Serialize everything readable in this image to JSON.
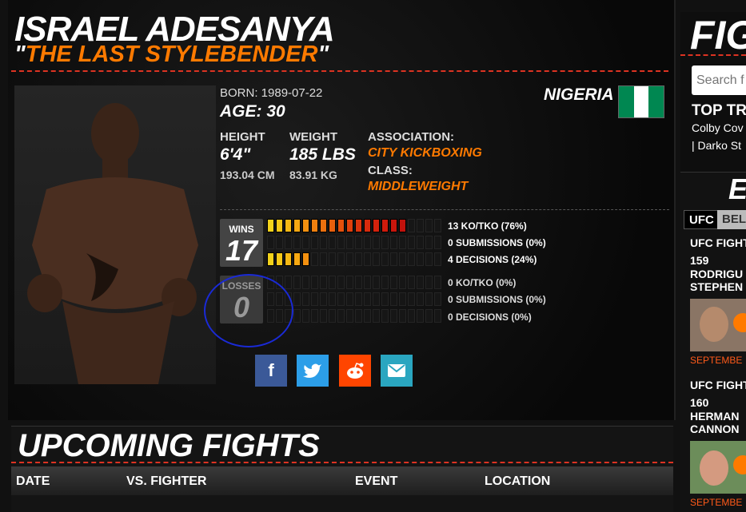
{
  "fighter": {
    "name": "ISRAEL ADESANYA",
    "nickname": "THE LAST STYLEBENDER",
    "quote_open": "\"",
    "quote_close": "\"",
    "born_label": "BORN: 1989-07-22",
    "age": "AGE: 30",
    "country": "NIGERIA",
    "height_label": "HEIGHT",
    "height_imperial": "6'4\"",
    "height_metric": "193.04 CM",
    "weight_label": "WEIGHT",
    "weight_imperial": "185 LBS",
    "weight_metric": "83.91 KG",
    "association_label": "ASSOCIATION:",
    "association": "CITY KICKBOXING",
    "class_label": "CLASS:",
    "class": "MIDDLEWEIGHT"
  },
  "colors": {
    "accent_orange": "#ff7a00",
    "divider_red": "#dd3322",
    "flag_green": "#008751",
    "flag_white": "#ffffff",
    "annotation_blue": "#1a2ad6"
  },
  "record": {
    "wins_label": "WINS",
    "wins": "17",
    "losses_label": "LOSSES",
    "losses": "0",
    "stats": [
      {
        "text": "13 KO/TKO (76%)",
        "filled": 16
      },
      {
        "text": "0 SUBMISSIONS (0%)",
        "filled": 0
      },
      {
        "text": "4 DECISIONS (24%)",
        "filled": 5
      },
      {
        "text": "0 KO/TKO (0%)",
        "filled": 0
      },
      {
        "text": "0 SUBMISSIONS (0%)",
        "filled": 0
      },
      {
        "text": "0 DECISIONS (0%)",
        "filled": 0
      }
    ]
  },
  "share": {
    "facebook": "facebook-icon",
    "twitter": "twitter-icon",
    "reddit": "reddit-icon",
    "email": "email-icon"
  },
  "upcoming": {
    "title": "UPCOMING FIGHTS",
    "columns": [
      "DATE",
      "VS. FIGHTER",
      "EVENT",
      "LOCATION"
    ]
  },
  "sidebar": {
    "title": "FIG",
    "search_placeholder": "Search f",
    "trending_title": "TOP TRE",
    "trending_items": [
      "Colby Cov",
      "| Darko St"
    ],
    "events_title": "E",
    "tabs": [
      "UFC",
      "BEL"
    ],
    "fights": [
      {
        "title": "UFC FIGHT",
        "number": "159",
        "names": [
          "RODRIGU",
          "STEPHEN"
        ],
        "date": "SEPTEMBE"
      },
      {
        "title": "UFC FIGHT",
        "number": "160",
        "names": [
          "HERMAN",
          "CANNON"
        ],
        "date": "SEPTEMBE"
      }
    ]
  }
}
